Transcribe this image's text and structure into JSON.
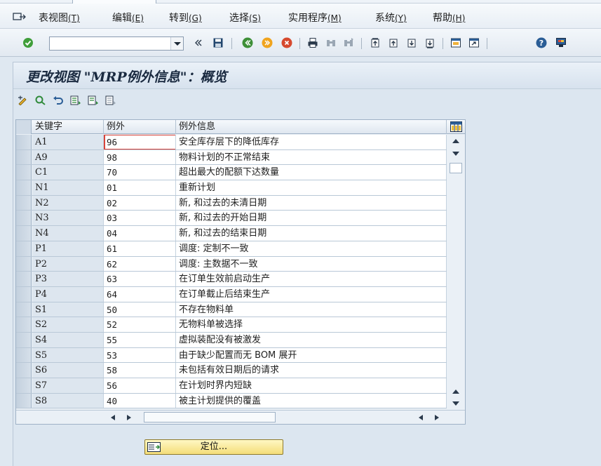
{
  "menu": [
    {
      "label": "表视图",
      "accel": "(T)"
    },
    {
      "label": "编辑",
      "accel": "(E)"
    },
    {
      "label": "转到",
      "accel": "(G)"
    },
    {
      "label": "选择",
      "accel": "(S)"
    },
    {
      "label": "实用程序",
      "accel": "(M)"
    },
    {
      "label": "系统",
      "accel": "(Y)"
    },
    {
      "label": "帮助",
      "accel": "(H)"
    }
  ],
  "command_field": {
    "value": ""
  },
  "page_title": "更改视图 \"MRP例外信息\"：概览",
  "table": {
    "columns": [
      "关键字",
      "例外",
      "例外信息"
    ],
    "rows": [
      {
        "key": "A1",
        "exception": "96",
        "info": "安全库存层下的降低库存"
      },
      {
        "key": "A9",
        "exception": "98",
        "info": "物料计划的不正常结束"
      },
      {
        "key": "C1",
        "exception": "70",
        "info": "超出最大的配额下达数量"
      },
      {
        "key": "N1",
        "exception": "01",
        "info": "重新计划"
      },
      {
        "key": "N2",
        "exception": "02",
        "info": "新, 和过去的未清日期"
      },
      {
        "key": "N3",
        "exception": "03",
        "info": "新, 和过去的开始日期"
      },
      {
        "key": "N4",
        "exception": "04",
        "info": "新, 和过去的结束日期"
      },
      {
        "key": "P1",
        "exception": "61",
        "info": "调度: 定制不一致"
      },
      {
        "key": "P2",
        "exception": "62",
        "info": "调度: 主数据不一致"
      },
      {
        "key": "P3",
        "exception": "63",
        "info": "在订单生效前启动生产"
      },
      {
        "key": "P4",
        "exception": "64",
        "info": "在订单截止后结束生产"
      },
      {
        "key": "S1",
        "exception": "50",
        "info": "不存在物料单"
      },
      {
        "key": "S2",
        "exception": "52",
        "info": "无物料单被选择"
      },
      {
        "key": "S4",
        "exception": "55",
        "info": "虚拟装配没有被激发"
      },
      {
        "key": "S5",
        "exception": "53",
        "info": "由于缺少配置而无 BOM 展开"
      },
      {
        "key": "S6",
        "exception": "58",
        "info": "未包括有效日期后的请求"
      },
      {
        "key": "S7",
        "exception": "56",
        "info": "在计划时界内短缺"
      },
      {
        "key": "S8",
        "exception": "40",
        "info": "被主计划提供的覆盖"
      }
    ]
  },
  "position_button": {
    "label": "定位..."
  },
  "colors": {
    "accent": "#f4dd78",
    "focus": "#d8433a",
    "background": "#dfe8f1"
  }
}
